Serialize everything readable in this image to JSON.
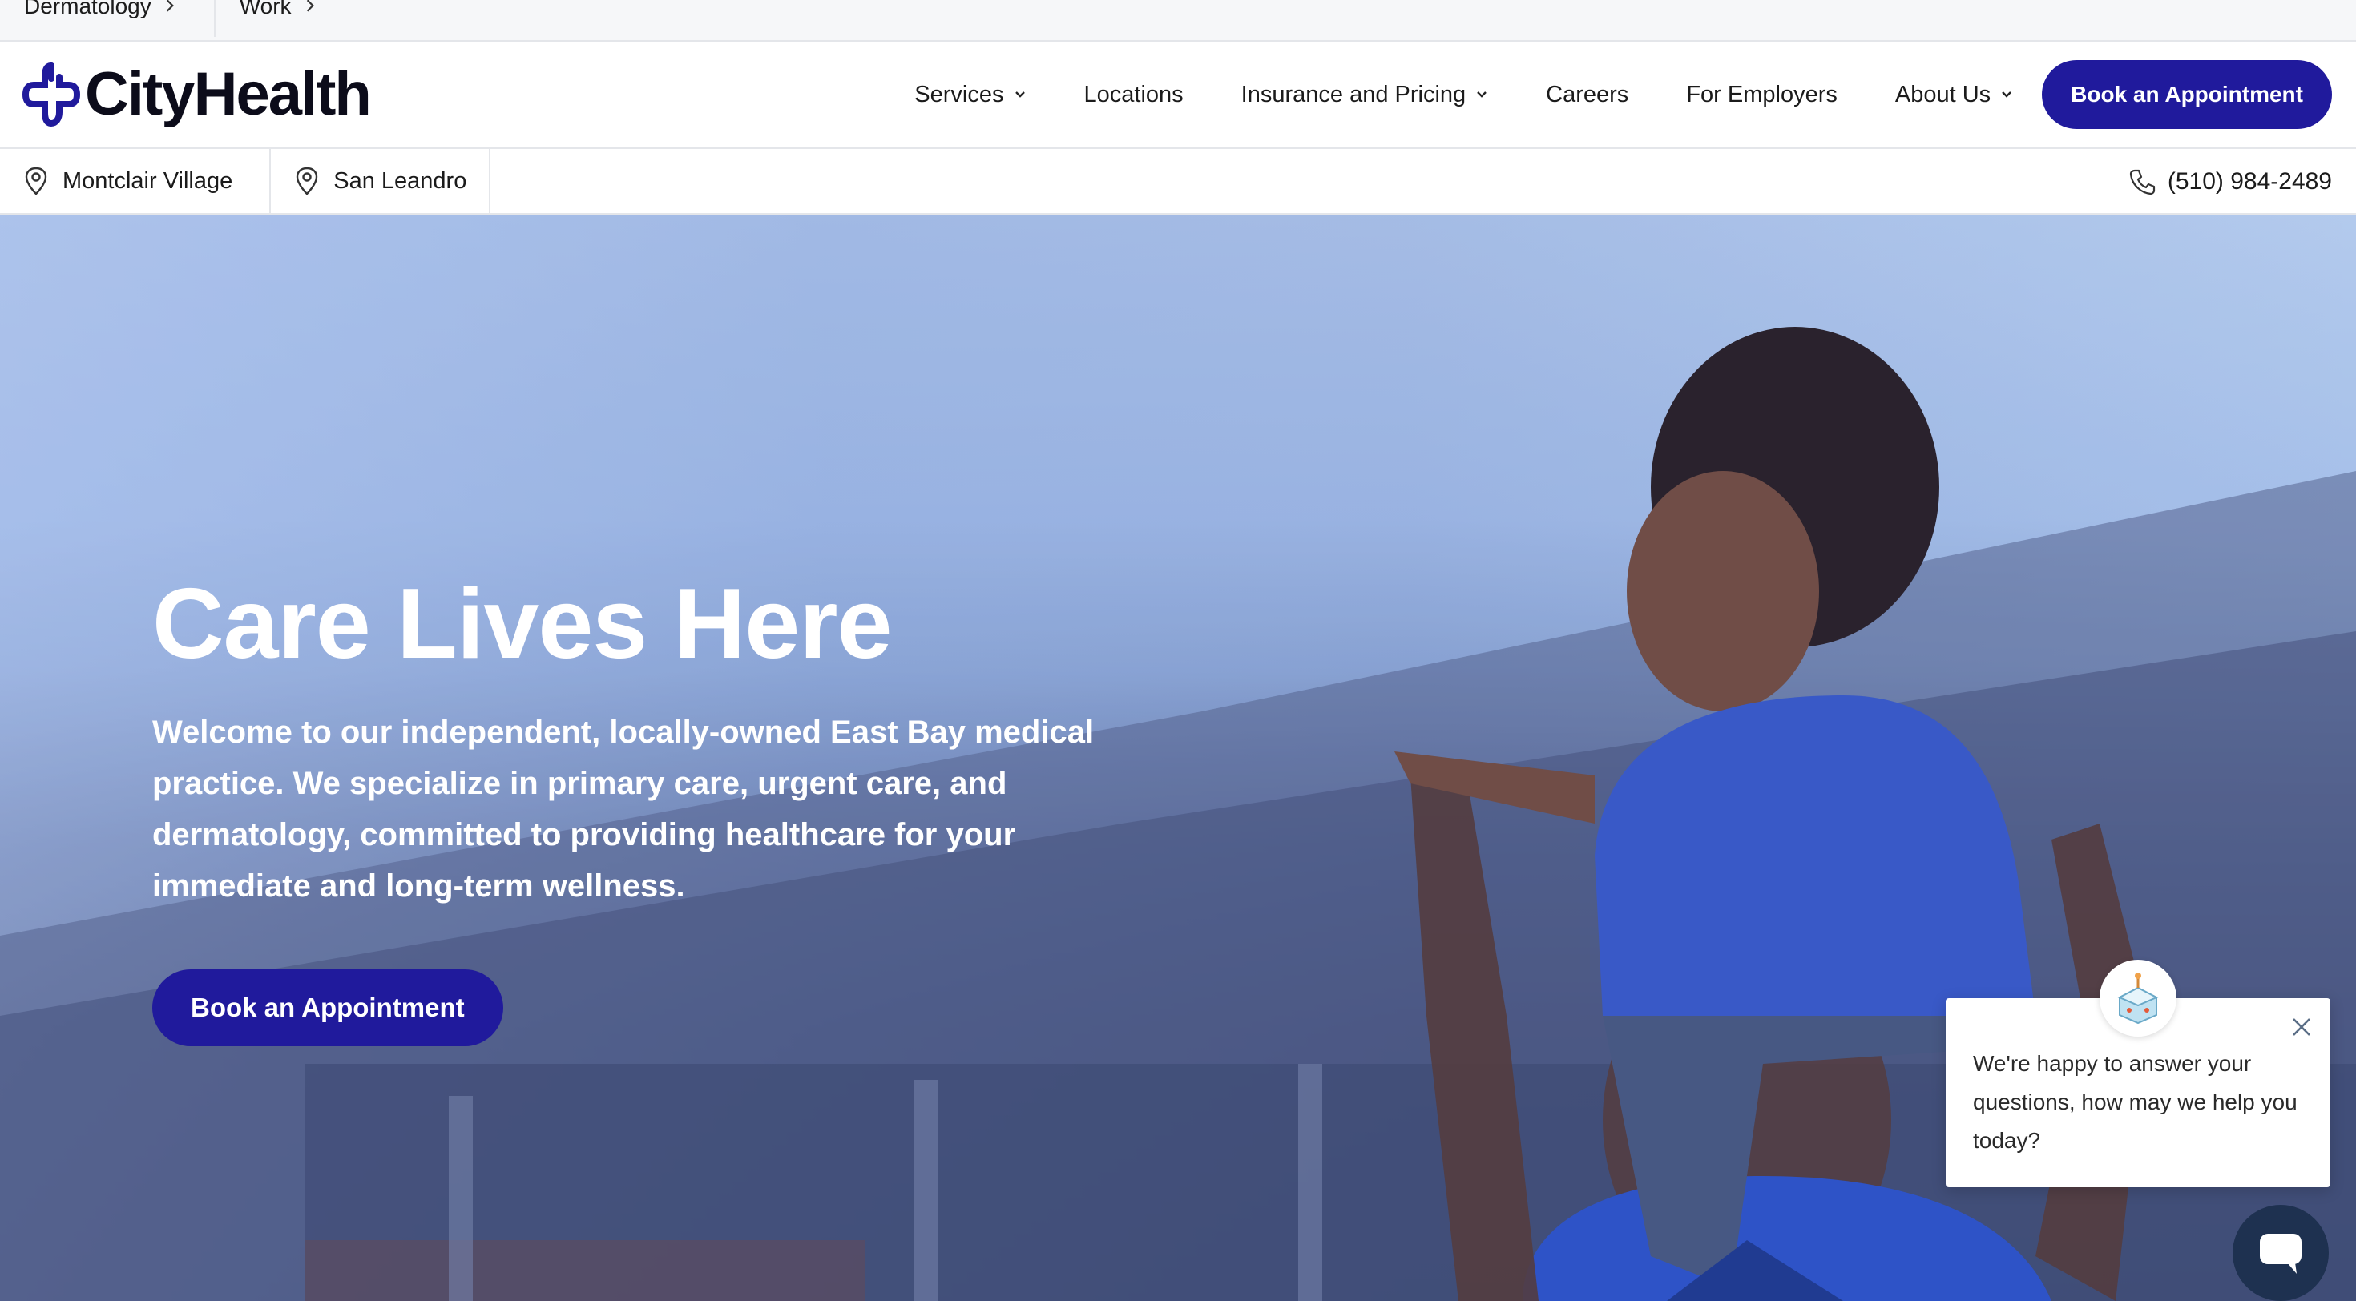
{
  "breadcrumbs": [
    {
      "label": "Dermatology"
    },
    {
      "label": "Work"
    }
  ],
  "brand": {
    "name": "CityHealth",
    "accent": "#201a9c"
  },
  "nav": {
    "items": [
      {
        "label": "Services",
        "dropdown": true
      },
      {
        "label": "Locations",
        "dropdown": false
      },
      {
        "label": "Insurance and Pricing",
        "dropdown": true
      },
      {
        "label": "Careers",
        "dropdown": false
      },
      {
        "label": "For Employers",
        "dropdown": false
      },
      {
        "label": "About Us",
        "dropdown": true
      }
    ],
    "cta_label": "Book an Appointment"
  },
  "locations": [
    {
      "label": "Montclair Village",
      "icon": "map-pin-icon"
    },
    {
      "label": "San Leandro",
      "icon": "map-pin-icon"
    }
  ],
  "phone": {
    "number": "(510) 984-2489",
    "icon": "phone-icon"
  },
  "hero": {
    "title": "Care Lives Here",
    "subtitle": "Welcome to our independent, locally-owned East Bay medical practice. We specialize in primary care, urgent care, and dermatology, committed to providing healthcare for your immediate and long-term wellness.",
    "cta_label": "Book an Appointment"
  },
  "chat": {
    "message": "We're happy to answer your questions, how may we help you today?",
    "launcher_icon": "chat-bubble-icon",
    "avatar_icon": "bot-avatar-icon"
  }
}
